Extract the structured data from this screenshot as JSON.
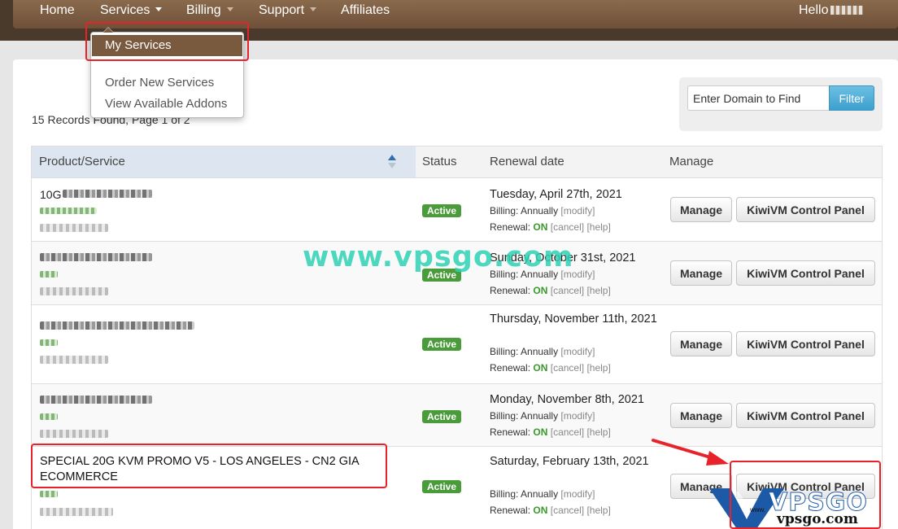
{
  "nav": {
    "home": "Home",
    "services": "Services",
    "billing": "Billing",
    "support": "Support",
    "affiliates": "Affiliates",
    "greeting": "Hello"
  },
  "services_menu": {
    "active": "My Services",
    "items": [
      "Order New Services",
      "View Available Addons"
    ]
  },
  "records_info": "15 Records Found, Page 1 of 2",
  "filter": {
    "placeholder": "Enter Domain to Find",
    "button": "Filter"
  },
  "table": {
    "headers": [
      "Product/Service",
      "Status",
      "Renewal date",
      "Manage"
    ],
    "rows": [
      {
        "product": "10G",
        "status": "Active",
        "date": "Tuesday, April 27th, 2021",
        "billing": "Annually",
        "renewal": "ON"
      },
      {
        "product": "",
        "status": "Active",
        "date": "Sunday, October 31st, 2021",
        "billing": "Annually",
        "renewal": "ON"
      },
      {
        "product": "",
        "status": "Active",
        "date": "Thursday, November 11th, 2021",
        "billing": "Annually",
        "renewal": "ON"
      },
      {
        "product": "",
        "status": "Active",
        "date": "Monday, November 8th, 2021",
        "billing": "Annually",
        "renewal": "ON"
      },
      {
        "product": "SPECIAL 20G KVM PROMO V5 - LOS ANGELES - CN2 GIA ECOMMERCE",
        "status": "Active",
        "date": "Saturday, February 13th, 2021",
        "billing": "Annually",
        "renewal": "ON"
      }
    ],
    "labels": {
      "billing": "Billing:",
      "renewal": "Renewal:",
      "modify": "modify",
      "cancel": "cancel",
      "help": "help",
      "manage_button": "Manage",
      "panel_button": "KiwiVM Control Panel"
    }
  },
  "watermark": "www.vpsgo.com",
  "logo": {
    "brand": "VPSGO",
    "www": "www.",
    "url": "vpsgo.com"
  },
  "colors": {
    "nav_brown": "#7a5a3f",
    "active_green": "#4a9b3a",
    "filter_blue": "#4aa8d6",
    "annotation_red": "#e8222a",
    "watermark_teal": "#2ed3b4"
  }
}
